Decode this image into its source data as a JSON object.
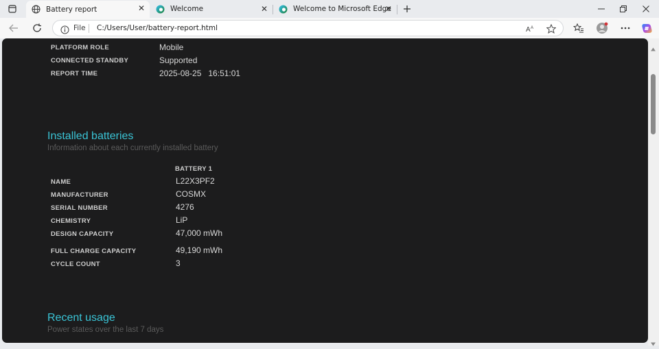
{
  "tabs": [
    {
      "title": "Battery report",
      "active": true,
      "favicon": "globe-icon"
    },
    {
      "title": "Welcome",
      "active": false,
      "favicon": "edge-icon"
    },
    {
      "title": "Welcome to Microsoft Edge",
      "active": false,
      "favicon": "edge-icon"
    }
  ],
  "omnibox": {
    "file_label": "File",
    "url": "C:/Users/User/battery-report.html"
  },
  "system": [
    {
      "label": "PLATFORM ROLE",
      "value": "Mobile"
    },
    {
      "label": "CONNECTED STANDBY",
      "value": "Supported"
    },
    {
      "label": "REPORT TIME",
      "value": "2025-08-25   16:51:01"
    }
  ],
  "installed": {
    "title": "Installed batteries",
    "subtitle": "Information about each currently installed battery",
    "column": "BATTERY 1",
    "rows": [
      {
        "label": "NAME",
        "value": "L22X3PF2"
      },
      {
        "label": "MANUFACTURER",
        "value": "COSMX"
      },
      {
        "label": "SERIAL NUMBER",
        "value": "4276"
      },
      {
        "label": "CHEMISTRY",
        "value": "LiP"
      },
      {
        "label": "DESIGN CAPACITY",
        "value": "47,000 mWh"
      },
      {
        "label": "FULL CHARGE CAPACITY",
        "value": "49,190 mWh"
      },
      {
        "label": "CYCLE COUNT",
        "value": "3"
      }
    ]
  },
  "recent": {
    "title": "Recent usage",
    "subtitle": "Power states over the last 7 days"
  },
  "colors": {
    "accent": "#3ac4d6",
    "page_bg": "#1c1c1d",
    "chrome_bg": "#e9ebee"
  }
}
